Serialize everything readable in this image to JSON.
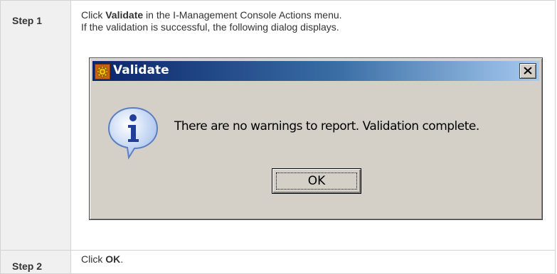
{
  "steps": [
    {
      "label": "Step 1",
      "line1_prefix": "Click ",
      "line1_bold": "Validate",
      "line1_suffix": " in the I-Management Console Actions menu.",
      "line2": "If the validation is successful, the following dialog displays."
    },
    {
      "label": "Step 2",
      "line1_prefix": "Click ",
      "line1_bold": "OK",
      "line1_suffix": "."
    }
  ],
  "dialog": {
    "title": "Validate",
    "message": "There are no warnings to report.  Validation complete.",
    "ok_label": "OK",
    "title_icon": "gear-icon",
    "message_icon": "info-icon",
    "close_icon": "close-icon"
  },
  "colors": {
    "label_cell_bg": "#f0f0f0",
    "border": "#d3d3d3",
    "dialog_bg": "#d4d0c8",
    "titlebar_start": "#0a246a",
    "titlebar_end": "#a6caf0"
  }
}
